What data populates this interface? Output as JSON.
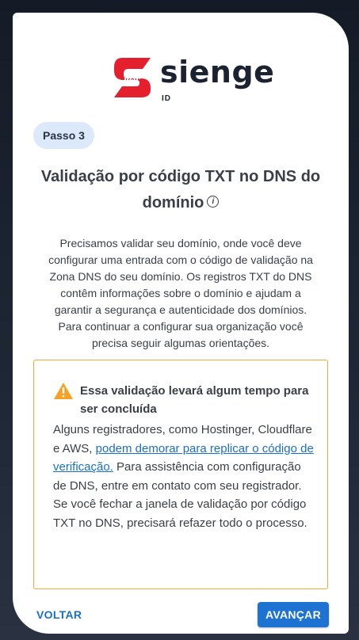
{
  "brand": {
    "name": "sienge",
    "sub": "ID",
    "color": "#e5202e"
  },
  "step_badge": "Passo 3",
  "title": "Validação por código TXT no DNS do domínio",
  "description": "Precisamos validar seu domínio, onde você deve configurar uma entrada com o código de validação na Zona DNS do seu domínio. Os registros TXT do DNS contêm informações sobre o domínio e ajudam a garantir a segurança e autenticidade dos domínios. Para continuar a configurar sua organização você precisa seguir algumas orientações.",
  "warning": {
    "title": "Essa validação levará algum tempo para ser concluída",
    "body_before": "Alguns registradores, como Hostinger, Cloudflare e AWS, ",
    "link": "podem demorar para replicar o código de verificação.",
    "body_after": " Para assistência com configuração de DNS, entre em contato com seu registrador. Se você fechar a janela de validação por código TXT no DNS, precisará refazer todo o processo.",
    "accent": "#f2a73a"
  },
  "actions": {
    "back": "VOLTAR",
    "next": "AVANÇAR",
    "primary_color": "#1e72d2"
  }
}
